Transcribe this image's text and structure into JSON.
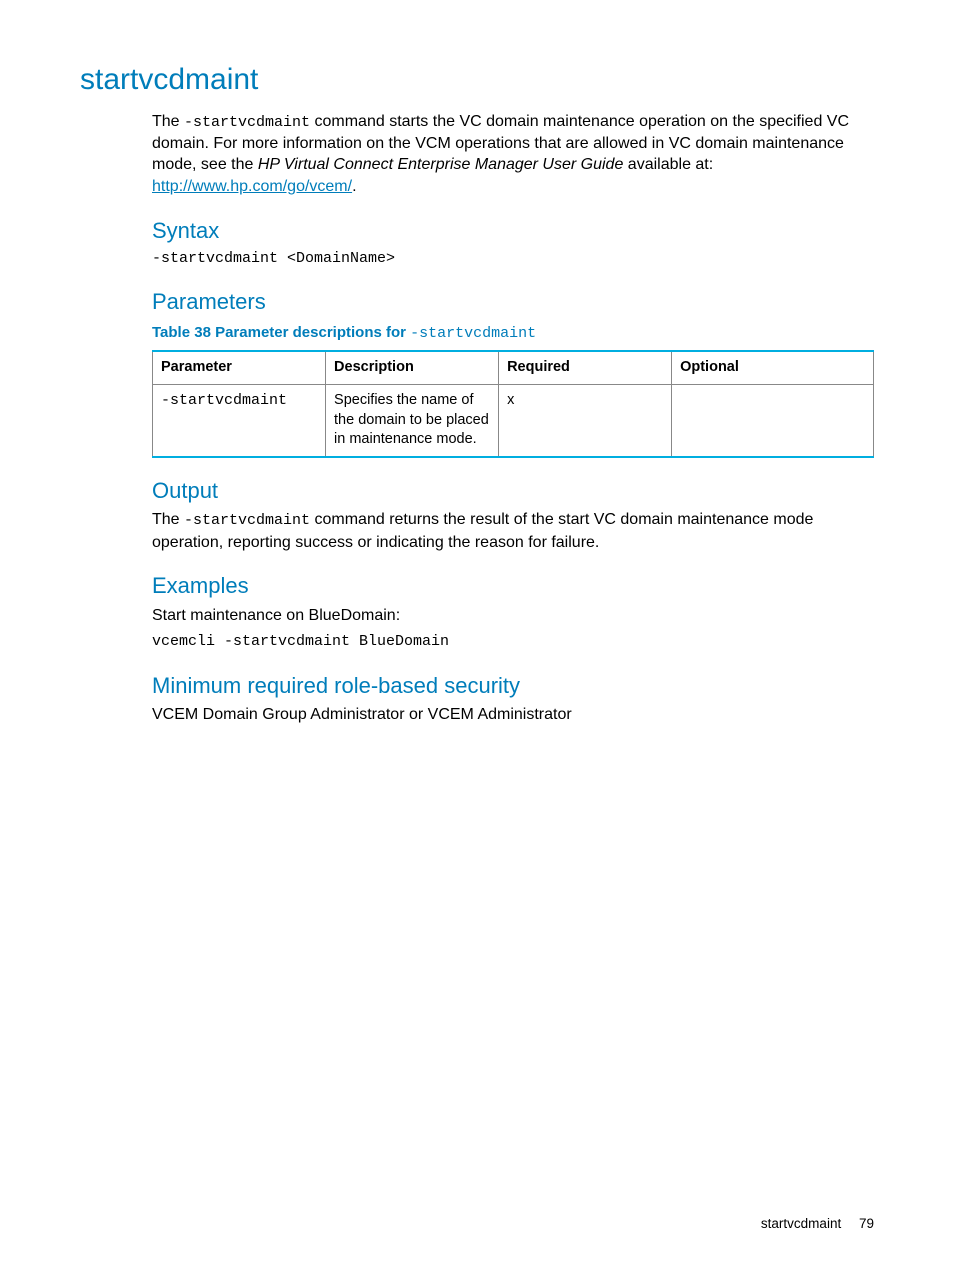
{
  "title": "startvcdmaint",
  "intro": {
    "t1": "The ",
    "cmd": "-startvcdmaint",
    "t2": " command starts the VC domain maintenance operation on the specified VC domain. For more information on the VCM operations that are allowed in VC domain maintenance mode, see the ",
    "guide": "HP Virtual Connect Enterprise Manager User Guide",
    "t3": " available at: ",
    "link": "http://www.hp.com/go/vcem/",
    "t4": "."
  },
  "syntax": {
    "heading": "Syntax",
    "line": "-startvcdmaint <DomainName>"
  },
  "parameters": {
    "heading": "Parameters",
    "caption_prefix": "Table 38 Parameter descriptions for ",
    "caption_cmd": "-startvcdmaint",
    "headers": {
      "p": "Parameter",
      "d": "Description",
      "r": "Required",
      "o": "Optional"
    },
    "row": {
      "param": "-startvcdmaint",
      "desc": "Specifies the name of the domain to be placed in maintenance mode.",
      "req": "x",
      "opt": ""
    }
  },
  "output": {
    "heading": "Output",
    "t1": "The ",
    "cmd": "-startvcdmaint",
    "t2": " command returns the result of the start VC domain maintenance mode operation, reporting success or indicating the reason for failure."
  },
  "examples": {
    "heading": "Examples",
    "intro": "Start maintenance on BlueDomain:",
    "line": "vcemcli -startvcdmaint BlueDomain"
  },
  "security": {
    "heading": "Minimum required role-based security",
    "text": "VCEM Domain Group Administrator or VCEM Administrator"
  },
  "footer": {
    "label": "startvcdmaint",
    "page": "79"
  }
}
